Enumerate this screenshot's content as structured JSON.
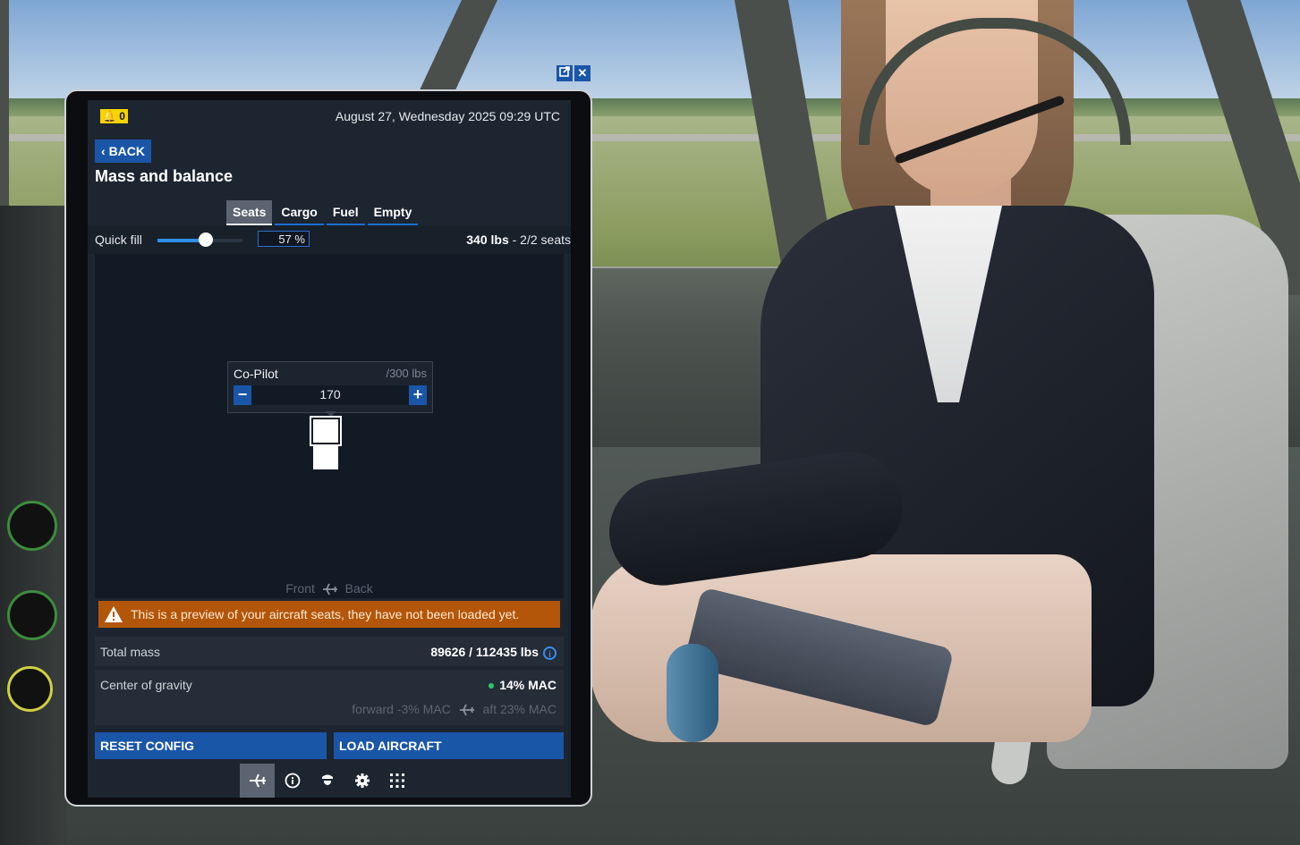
{
  "window_controls": {
    "popout_icon": "popout-icon",
    "close_icon": "close-icon"
  },
  "header": {
    "notification_count": "0",
    "datetime": "August 27, Wednesday 2025 09:29 UTC"
  },
  "back_label": "BACK",
  "page_title": "Mass and balance",
  "tabs": [
    {
      "label": "Seats",
      "active": true
    },
    {
      "label": "Cargo",
      "active": false
    },
    {
      "label": "Fuel",
      "active": false
    },
    {
      "label": "Empty",
      "active": false
    }
  ],
  "quick_fill": {
    "label": "Quick fill",
    "value": "57 %",
    "fraction": 0.57,
    "summary_weight": "340 lbs",
    "summary_seats": " - 2/2 seats"
  },
  "seat_popup": {
    "name": "Co-Pilot",
    "max": "/300 lbs",
    "value": "170",
    "minus": "−",
    "plus": "+"
  },
  "axis": {
    "front": "Front",
    "back": "Back"
  },
  "warning": "This is a preview of your aircraft seats, they have not been loaded yet.",
  "total_mass": {
    "label": "Total mass",
    "value": "89626 / 112435 lbs"
  },
  "center_of_gravity": {
    "label": "Center of gravity",
    "value": "14% MAC",
    "forward": "forward -3% MAC",
    "aft": "aft 23% MAC"
  },
  "buttons": {
    "reset": "RESET CONFIG",
    "load": "LOAD AIRCRAFT"
  },
  "bottom_nav": [
    {
      "icon": "airplane-icon",
      "active": true
    },
    {
      "icon": "info-icon",
      "active": false
    },
    {
      "icon": "pilot-icon",
      "active": false
    },
    {
      "icon": "settings-icon",
      "active": false
    },
    {
      "icon": "apps-grid-icon",
      "active": false
    }
  ]
}
